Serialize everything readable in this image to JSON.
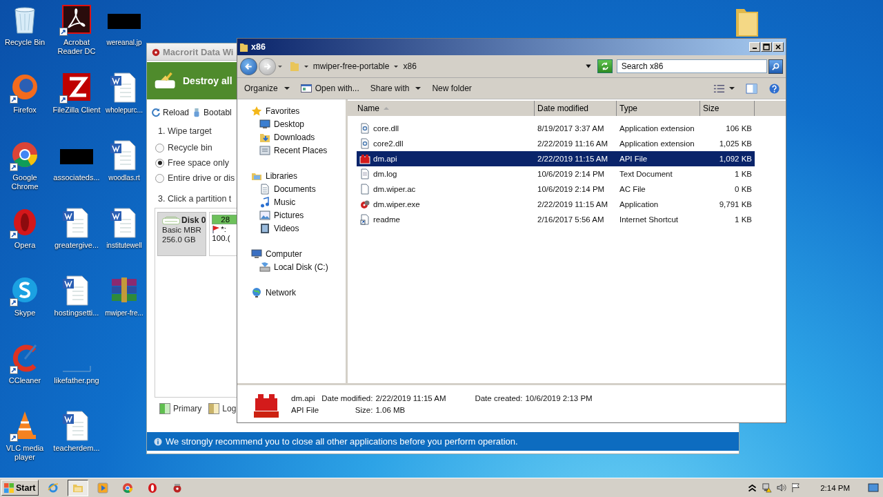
{
  "desktop_icons": [
    {
      "label": "Recycle Bin",
      "kind": "recycle",
      "shortcut": false
    },
    {
      "label": "Firefox",
      "kind": "firefox",
      "shortcut": true
    },
    {
      "label": "Google Chrome",
      "kind": "chrome",
      "shortcut": true
    },
    {
      "label": "Opera",
      "kind": "opera",
      "shortcut": true
    },
    {
      "label": "Skype",
      "kind": "skype",
      "shortcut": true
    },
    {
      "label": "CCleaner",
      "kind": "ccleaner",
      "shortcut": true
    },
    {
      "label": "VLC media player",
      "kind": "vlc",
      "shortcut": true
    },
    {
      "label": "Acrobat Reader DC",
      "kind": "pdf",
      "shortcut": true
    },
    {
      "label": "FileZilla Client",
      "kind": "filezilla",
      "shortcut": true
    },
    {
      "label": "associateds...",
      "kind": "redacted",
      "shortcut": false
    },
    {
      "label": "greatergive...",
      "kind": "word",
      "shortcut": false
    },
    {
      "label": "hostingsetti...",
      "kind": "word",
      "shortcut": false
    },
    {
      "label": "likefather.png",
      "kind": "blank",
      "shortcut": false
    },
    {
      "label": "teacherdem...",
      "kind": "word",
      "shortcut": false
    },
    {
      "label": "wereanal.jp",
      "kind": "redacted",
      "shortcut": false
    },
    {
      "label": "wholepurc...",
      "kind": "word",
      "shortcut": false
    },
    {
      "label": "woodlas.rt",
      "kind": "word",
      "shortcut": false
    },
    {
      "label": "institutewell",
      "kind": "word",
      "shortcut": false
    },
    {
      "label": "mwiper-fre...",
      "kind": "winrar",
      "shortcut": false
    }
  ],
  "wiper": {
    "title": "Macrorit Data Wi",
    "banner": "Destroy all",
    "toolbar": [
      {
        "label": "Reload",
        "kind": "reload"
      },
      {
        "label": "Bootabl",
        "kind": "usb"
      }
    ],
    "section_1": "1. Wipe target",
    "options": [
      {
        "label": "Recycle bin",
        "selected": false
      },
      {
        "label": "Free space only",
        "selected": true
      },
      {
        "label": "Entire drive or dis",
        "selected": false
      }
    ],
    "section_3": "3. Click a partition t",
    "disk": {
      "name": "Disk 0",
      "type": "Basic MBR",
      "size": "256.0 GB"
    },
    "partition": {
      "used": "28",
      "letter": "*:",
      "size": "100.("
    },
    "legend": [
      {
        "label": "Primary",
        "kind": "primary"
      },
      {
        "label": "Log",
        "kind": "logical"
      }
    ],
    "notice": "We strongly recommend you to close all other applications before you perform operation."
  },
  "explorer": {
    "title": "x86",
    "breadcrumb": [
      "mwiper-free-portable",
      "x86"
    ],
    "search": {
      "placeholder": "Search x86"
    },
    "toolbar": [
      {
        "label": "Organize",
        "kind": "menu"
      },
      {
        "label": "Open with...",
        "kind": "app"
      },
      {
        "label": "Share with",
        "kind": "menu"
      },
      {
        "label": "New folder",
        "kind": "plain"
      }
    ],
    "nav": [
      {
        "label": "Favorites",
        "kind": "star",
        "children": [
          {
            "label": "Desktop",
            "kind": "desktop"
          },
          {
            "label": "Downloads",
            "kind": "downloads"
          },
          {
            "label": "Recent Places",
            "kind": "recent"
          }
        ]
      },
      {
        "label": "Libraries",
        "kind": "library",
        "children": [
          {
            "label": "Documents",
            "kind": "documents"
          },
          {
            "label": "Music",
            "kind": "music"
          },
          {
            "label": "Pictures",
            "kind": "pictures"
          },
          {
            "label": "Videos",
            "kind": "videos"
          }
        ]
      },
      {
        "label": "Computer",
        "kind": "computer",
        "children": [
          {
            "label": "Local Disk (C:)",
            "kind": "disk"
          }
        ]
      },
      {
        "label": "Network",
        "kind": "network"
      }
    ],
    "columns": [
      {
        "label": "Name",
        "sorted": true
      },
      {
        "label": "Date modified",
        "sorted": false
      },
      {
        "label": "Type",
        "sorted": false
      },
      {
        "label": "Size",
        "sorted": false
      }
    ],
    "files": [
      {
        "name": "core.dll",
        "date": "8/19/2017 3:37 AM",
        "type": "Application extension",
        "size": "106 KB",
        "kind": "dll",
        "selected": false
      },
      {
        "name": "core2.dll",
        "date": "2/22/2019 11:16 AM",
        "type": "Application extension",
        "size": "1,025 KB",
        "kind": "dll",
        "selected": false
      },
      {
        "name": "dm.api",
        "date": "2/22/2019 11:15 AM",
        "type": "API File",
        "size": "1,092 KB",
        "kind": "api",
        "selected": true
      },
      {
        "name": "dm.log",
        "date": "10/6/2019 2:14 PM",
        "type": "Text Document",
        "size": "1 KB",
        "kind": "text",
        "selected": false
      },
      {
        "name": "dm.wiper.ac",
        "date": "10/6/2019 2:14 PM",
        "type": "AC File",
        "size": "0 KB",
        "kind": "blank",
        "selected": false
      },
      {
        "name": "dm.wiper.exe",
        "date": "2/22/2019 11:15 AM",
        "type": "Application",
        "size": "9,791 KB",
        "kind": "exe",
        "selected": false
      },
      {
        "name": "readme",
        "date": "2/16/2017 5:56 AM",
        "type": "Internet Shortcut",
        "size": "1 KB",
        "kind": "url",
        "selected": false
      }
    ],
    "details": {
      "name": "dm.api",
      "type": "API File",
      "modified_label": "Date modified:",
      "modified": "2/22/2019 11:15 AM",
      "created_label": "Date created:",
      "created": "10/6/2019 2:13 PM",
      "size_label": "Size:",
      "size": "1.06 MB"
    }
  },
  "taskbar": {
    "start": "Start",
    "apps": [
      {
        "kind": "ie",
        "active": false
      },
      {
        "kind": "explorer",
        "active": true
      },
      {
        "kind": "media",
        "active": false
      },
      {
        "kind": "chrome",
        "active": false
      },
      {
        "kind": "opera",
        "active": false
      },
      {
        "kind": "wiper",
        "active": false
      }
    ],
    "clock": "2:14 PM"
  }
}
